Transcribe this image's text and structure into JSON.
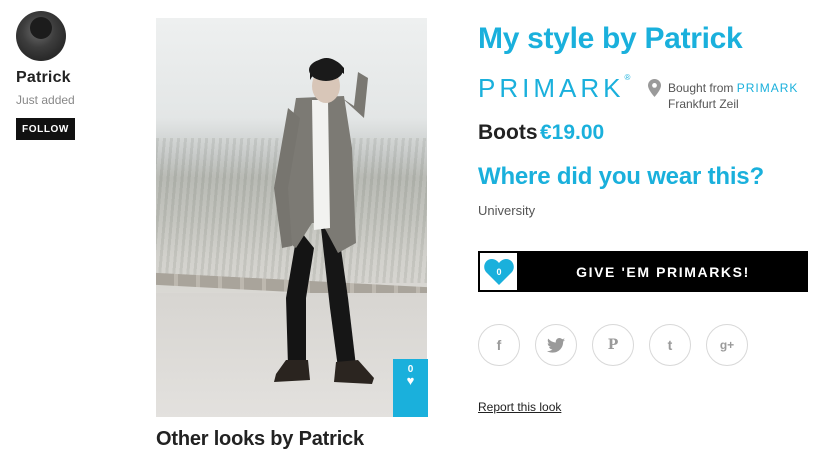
{
  "user": {
    "name": "Patrick",
    "status": "Just added",
    "follow_label": "FOLLOW"
  },
  "look": {
    "likes": "0",
    "other_looks": "Other looks by Patrick"
  },
  "detail": {
    "title": "My style by Patrick",
    "brand": "PRIMARK",
    "brand_mark": "®",
    "bought_prefix": "Bought from",
    "bought_store": "PRIMARK",
    "location": "Frankfurt Zeil",
    "item_name": "Boots",
    "item_price": "€19.00",
    "where_question": "Where did you wear this?",
    "where_answer": "University"
  },
  "give": {
    "count": "0",
    "label": "GIVE 'EM PRIMARKS!"
  },
  "social": [
    {
      "icon": "facebook-icon",
      "glyph": "f"
    },
    {
      "icon": "twitter-icon",
      "glyph": "t"
    },
    {
      "icon": "pinterest-icon",
      "glyph": "P"
    },
    {
      "icon": "tumblr-icon",
      "glyph": "t"
    },
    {
      "icon": "google-plus-icon",
      "glyph": "g+"
    }
  ],
  "report_label": "Report this look",
  "colors": {
    "accent": "#1ab0dc",
    "dark": "#111111"
  }
}
